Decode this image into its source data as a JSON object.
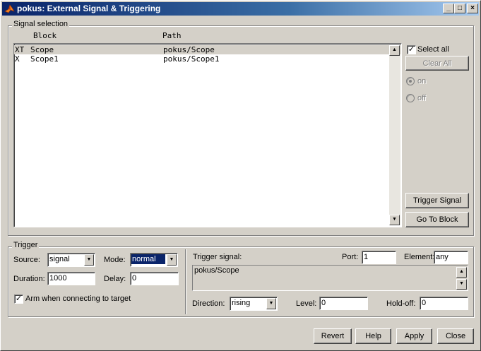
{
  "window": {
    "title": "pokus: External Signal & Triggering",
    "controls": {
      "minimize": "_",
      "maximize": "□",
      "close": "×"
    }
  },
  "signal_selection": {
    "group_label": "Signal selection",
    "columns": {
      "block": "Block",
      "path": "Path"
    },
    "rows": [
      {
        "flag": "XT",
        "block": "Scope",
        "path": "pokus/Scope",
        "selected": true
      },
      {
        "flag": "X",
        "block": "Scope1",
        "path": "pokus/Scope1",
        "selected": false
      }
    ],
    "select_all_label": "Select all",
    "select_all_checked": true,
    "clear_all_label": "Clear All",
    "radio_on_label": "on",
    "radio_off_label": "off",
    "trigger_signal_button": "Trigger Signal",
    "go_to_block_button": "Go To Block"
  },
  "trigger": {
    "group_label": "Trigger",
    "source_label": "Source:",
    "source_value": "signal",
    "mode_label": "Mode:",
    "mode_value": "normal",
    "duration_label": "Duration:",
    "duration_value": "1000",
    "delay_label": "Delay:",
    "delay_value": "0",
    "arm_label": "Arm when connecting to target",
    "arm_checked": true,
    "trigger_signal_label": "Trigger signal:",
    "trigger_signal_value": "pokus/Scope",
    "port_label": "Port:",
    "port_value": "1",
    "element_label": "Element:",
    "element_value": "any",
    "direction_label": "Direction:",
    "direction_value": "rising",
    "level_label": "Level:",
    "level_value": "0",
    "holdoff_label": "Hold-off:",
    "holdoff_value": "0"
  },
  "footer": {
    "revert": "Revert",
    "help": "Help",
    "apply": "Apply",
    "close": "Close"
  },
  "colors": {
    "face": "#d4d0c8",
    "title_start": "#0a246a",
    "title_end": "#a6caf0",
    "selection": "#0a246a"
  }
}
